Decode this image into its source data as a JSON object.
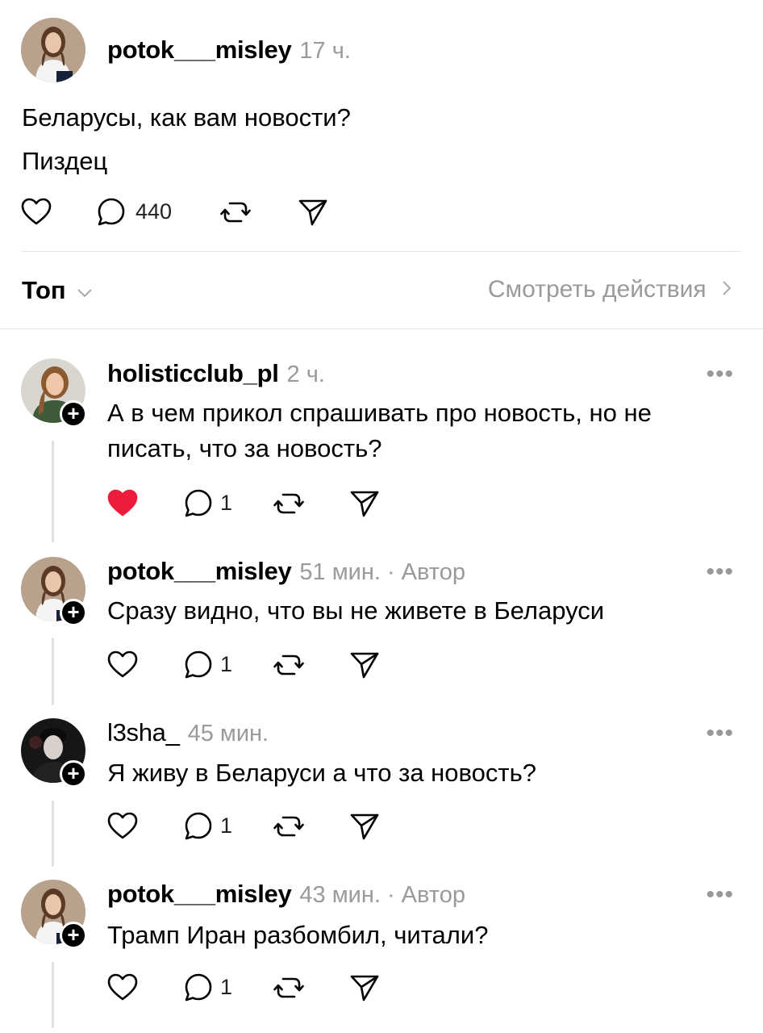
{
  "post": {
    "username": "potok___misley",
    "time": "17 ч.",
    "lines": [
      "Беларусы, как вам новости?",
      "Пиздец"
    ],
    "reply_count": "440",
    "icons": [
      "heart-icon",
      "comment-icon",
      "repost-icon",
      "share-icon"
    ]
  },
  "sort": {
    "label": "Топ",
    "chevron": "chevron-down-icon",
    "activity_link": "Смотреть действия",
    "activity_chevron": "chevron-right-icon"
  },
  "comments": [
    {
      "username": "holisticclub_pl",
      "time": "2 ч.",
      "author_tag": "",
      "lines": [
        "А в чем прикол спрашивать про новость, но не",
        "писать, что за новость?"
      ],
      "liked": true,
      "like_color": "#ed1c3a",
      "reply_count": "1"
    },
    {
      "username": "potok___misley",
      "time": "51 мин.",
      "author_tag": "· Автор",
      "lines": [
        "Сразу видно, что вы не живете в Беларуси"
      ],
      "liked": false,
      "reply_count": "1"
    },
    {
      "username": "l3sha_",
      "time": "45 мин.",
      "author_tag": "",
      "lines": [
        "Я живу в Беларуси а что за новость?"
      ],
      "liked": false,
      "reply_count": "1"
    },
    {
      "username": "potok___misley",
      "time": "43 мин.",
      "author_tag": "· Автор",
      "lines": [
        "Трамп Иран разбомбил, читали?"
      ],
      "liked": false,
      "reply_count": "1"
    }
  ],
  "more_icon": "•••"
}
